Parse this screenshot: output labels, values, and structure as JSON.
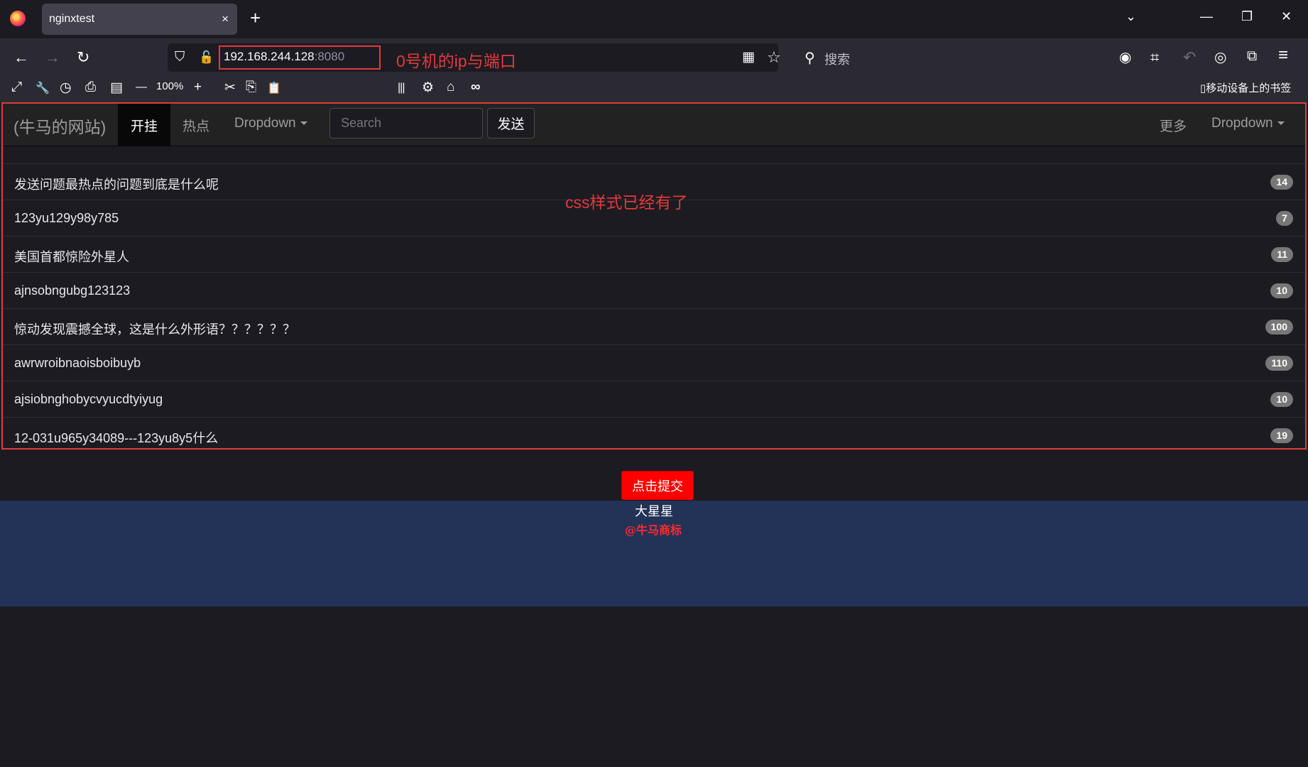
{
  "browser": {
    "tab_title": "nginxtest",
    "tab_close": "×",
    "new_tab": "+",
    "window_controls": {
      "list": "⌄",
      "minimize": "—",
      "restore": "❐",
      "close": "✕"
    },
    "nav_icons": {
      "back": "←",
      "forward": "→",
      "reload": "↻",
      "shield": "⛉",
      "lock": "🔓",
      "qr": "▦",
      "star": "☆",
      "search": "⚲"
    },
    "url_host": "192.168.244.128",
    "url_port": ":8080",
    "url_annotation": "0号机的ip与端口",
    "search_placeholder": "搜索",
    "toolbar_right_icons": {
      "ext1": "◉",
      "crop": "⌗",
      "undo": "↶",
      "ext2": "◎",
      "puzzle": "⧉",
      "menu": "≡"
    },
    "toolbar2_icons": {
      "fullscreen": "⤢",
      "wrench": "🔧",
      "history": "◷",
      "folder": "⎙",
      "reader": "▤",
      "zoom_out": "—",
      "zoom_in": "+",
      "cut": "✂",
      "copy": "⎘",
      "paste": "📋",
      "library": "|||",
      "settings": "⚙",
      "home": "⌂",
      "mask": "∞"
    },
    "zoom_level": "100%",
    "mobile_bookmarks": "▯移动设备上的书签"
  },
  "site": {
    "brand": "(牛马的网站)",
    "tabs": [
      "开挂",
      "热点",
      "Dropdown"
    ],
    "search_placeholder": "Search",
    "send_label": "发送",
    "right_tabs": [
      "更多",
      "Dropdown"
    ],
    "list": [
      {
        "label": "发送问题最热点的问题到底是什么呢",
        "badge": "14"
      },
      {
        "label": "123yu129y98y785",
        "badge": "7"
      },
      {
        "label": "美国首都惊险外星人",
        "badge": "11"
      },
      {
        "label": "ajnsobngubg123123",
        "badge": "10"
      },
      {
        "label": "惊动发现震撼全球，这是什么外形语？？？？？？",
        "badge": "100"
      },
      {
        "label": "awrwroibnaoisboibuyb",
        "badge": "110"
      },
      {
        "label": "ajsiobnghobycvyucdtyiyug",
        "badge": "10"
      },
      {
        "label": "12-031u965y34089---123yu8y5什么",
        "badge": "19"
      }
    ],
    "css_annotation": "css样式已经有了",
    "submit_label": "点击提交",
    "footer_name": "大星星",
    "footer_mark": "@牛马商标"
  },
  "colors": {
    "annotation": "#e23b3b",
    "submit": "#ff0000",
    "footer_bg": "#223357",
    "badge": "#777777"
  }
}
